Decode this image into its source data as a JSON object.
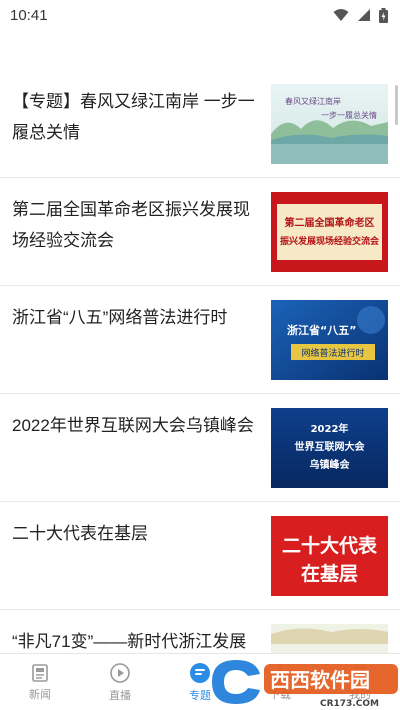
{
  "status": {
    "time": "10:41"
  },
  "feed": [
    {
      "title": "【专题】春风又绿江南岸 一步一履总关情",
      "thumb_text_1": "春风又绿江南岸",
      "thumb_text_2": "一步一履总关情"
    },
    {
      "title": "第二届全国革命老区振兴发展现场经验交流会",
      "thumb_text_1": "第二届全国革命老区",
      "thumb_text_2": "振兴发展现场经验交流会"
    },
    {
      "title": "浙江省“八五”网络普法进行时",
      "thumb_text_1": "浙江省“八五”",
      "thumb_text_2": "网络普法进行时"
    },
    {
      "title": "2022年世界互联网大会乌镇峰会",
      "thumb_text_1": "2022年",
      "thumb_text_2": "世界互联网大会",
      "thumb_text_3": "乌镇峰会"
    },
    {
      "title": "二十大代表在基层",
      "thumb_text_1": "二十大代表",
      "thumb_text_2": "在基层"
    },
    {
      "title": "“非凡71变”——新时代浙江发展"
    }
  ],
  "tabs": [
    {
      "label": "新闻",
      "icon": "news-icon"
    },
    {
      "label": "直播",
      "icon": "play-icon"
    },
    {
      "label": "专题",
      "icon": "topic-icon"
    },
    {
      "label": "下载",
      "icon": "download-icon"
    },
    {
      "label": "我的",
      "icon": "user-icon"
    }
  ],
  "watermark": {
    "brand": "西西软件园",
    "url": "CR173.COM"
  },
  "colors": {
    "accent": "#2b8de6",
    "thumb_red": "#d81e1e",
    "thumb_blue": "#0f3f8c"
  }
}
